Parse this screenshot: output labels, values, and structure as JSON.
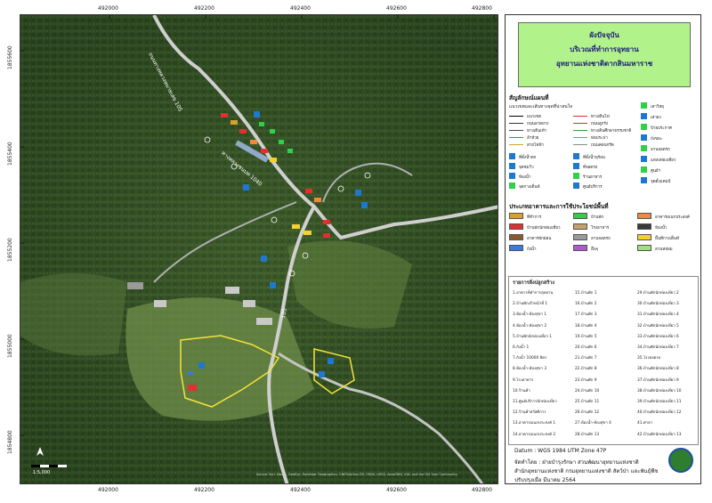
{
  "map": {
    "x_ticks": [
      "492000",
      "492200",
      "492400",
      "492600",
      "492800"
    ],
    "y_ticks": [
      "1855600",
      "1855400",
      "1855200",
      "1855000",
      "1854800"
    ],
    "road_labels": [
      "ถนนทางหลวงหมายเลข 105",
      "ทางหลวงชนบท 1040",
      "105"
    ],
    "scale_label": "1:5,000",
    "credits": "Source: Esri, Maxar, GeoEye, Earthstar Geographics, CNES/Airbus DS, USDA, USGS, AeroGRID, IGN, and the GIS User Community"
  },
  "title": {
    "line1": "ผังปัจจุบัน",
    "line2": "บริเวณที่ทำการอุทยาน",
    "line3": "อุทยานแห่งชาติตากสินมหาราช"
  },
  "legend": {
    "symbols_heading": "สัญลักษณ์แผนที่",
    "symbols_subheading": "แนวเขตและเส้นทางจุดที่น่าสนใจ",
    "line_items": [
      "แนวเขต",
      "ทางเดินไฟ",
      "ถนนลาดยาง",
      "ถนนลูกรัง",
      "ทางเดินเท้า",
      "ทางเดินศึกษาธรรมชาติ",
      "ลำห้วย",
      "ท่อประปา",
      "สายไฟฟ้า",
      "ถนนคอนกรีต"
    ],
    "point_items": [
      "ที่ตั้งน้ำตก",
      "ที่ตั้งน้ำพุร้อน",
      "จุดชมวิว",
      "ที่จอดรถ",
      "ห้องน้ำ",
      "ร้านอาหาร",
      "จุดกางเต็นท์",
      "ศูนย์บริการ"
    ],
    "right_items": [
      "เสาวิทยุ",
      "เสาธง",
      "ป้ายประกาศ",
      "ถังขยะ",
      "ลานจอดรถ",
      "แหล่งท่องเที่ยว",
      "ศูนย์ฯ",
      "จุดตั้งแคมป์"
    ],
    "landuse_heading": "ประเภทอาคารและการใช้ประโยชน์พื้นที่",
    "landuse_items": [
      {
        "label": "ที่ทำการ",
        "color": "#d9a12a"
      },
      {
        "label": "บ้านพัก",
        "color": "#2fd04a"
      },
      {
        "label": "อาคารอเนกประสงค์",
        "color": "#ee8a3a"
      },
      {
        "label": "บ้านพักนักท่องเที่ยว",
        "color": "#e03030"
      },
      {
        "label": "โรงอาหาร",
        "color": "#c7a06a"
      },
      {
        "label": "ห้องน้ำ",
        "color": "#3a3a3a"
      },
      {
        "label": "อาคารพักผ่อน",
        "color": "#8a5a2a"
      },
      {
        "label": "ลานจอดรถ",
        "color": "#9a9a9a"
      },
      {
        "label": "พื้นที่กางเต็นท์",
        "color": "#f5d22a"
      },
      {
        "label": "ถังน้ำ",
        "color": "#3a7adf"
      },
      {
        "label": "อื่นๆ",
        "color": "#b05ad0"
      },
      {
        "label": "สวนหย่อม",
        "color": "#a0e080"
      }
    ],
    "list_heading": "รายการสิ่งปลูกสร้าง",
    "list_col1": [
      "1.อาคารที่ทำการอุทยาน",
      "2.บ้านพักเจ้าหน้าที่ 1",
      "3.ห้องน้ำ-ห้องสุขา 1",
      "4.ห้องน้ำ-ห้องสุขา 2",
      "5.บ้านพักนักท่องเที่ยว 1",
      "6.ถังน้ำ 1",
      "7.ถังน้ำ 10000 ลิตร",
      "8.ห้องน้ำ-ห้องสุขา 3",
      "9.โรงอาหาร",
      "10.ร้านค้า",
      "11.ศูนย์บริการนักท่องเที่ยว",
      "12.ร้านค้าสวัสดิการ",
      "13.อาคารอเนกประสงค์ 1",
      "14.อาคารอเนกประสงค์ 2"
    ],
    "list_col2": [
      "15.บ้านพัก 1",
      "16.บ้านพัก 2",
      "17.บ้านพัก 3",
      "18.บ้านพัก 4",
      "19.บ้านพัก 5",
      "20.บ้านพัก 6",
      "21.บ้านพัก 7",
      "22.บ้านพัก 8",
      "23.บ้านพัก 9",
      "24.บ้านพัก 10",
      "25.บ้านพัก 11",
      "26.บ้านพัก 12",
      "27.ห้องน้ำ-ห้องสุขา 4",
      "28.บ้านพัก 13"
    ],
    "list_col3": [
      "29.บ้านพักนักท่องเที่ยว 2",
      "30.บ้านพักนักท่องเที่ยว 3",
      "31.บ้านพักนักท่องเที่ยว 4",
      "32.บ้านพักนักท่องเที่ยว 5",
      "33.บ้านพักนักท่องเที่ยว 6",
      "34.บ้านพักนักท่องเที่ยว 7",
      "35.โรงจอดรถ",
      "36.บ้านพักนักท่องเที่ยว 8",
      "37.บ้านพักนักท่องเที่ยว 9",
      "38.บ้านพักนักท่องเที่ยว 10",
      "39.บ้านพักนักท่องเที่ยว 11",
      "40.บ้านพักนักท่องเที่ยว 12",
      "41.ศาลา",
      "42.บ้านพักนักท่องเที่ยว 13"
    ]
  },
  "footer": {
    "datum": "Datum  :  WGS 1984 UTM Zone 47P",
    "made_by": "จัดทำโดย  :  ฝ่ายบำรุงรักษา ส่วนพัฒนาอุทยานแห่งชาติ",
    "office": "สำนักอุทยานแห่งชาติ  กรมอุทยานแห่งชาติ สัตว์ป่า และพันธุ์พืช",
    "updated": "ปรับปรุงเมื่อ มีนาคม 2564"
  },
  "colors": {
    "title_bg": "#b2f28a",
    "boundary": "#f5e23a",
    "road": "#bdbdbd",
    "forest": "#2f4a22"
  }
}
